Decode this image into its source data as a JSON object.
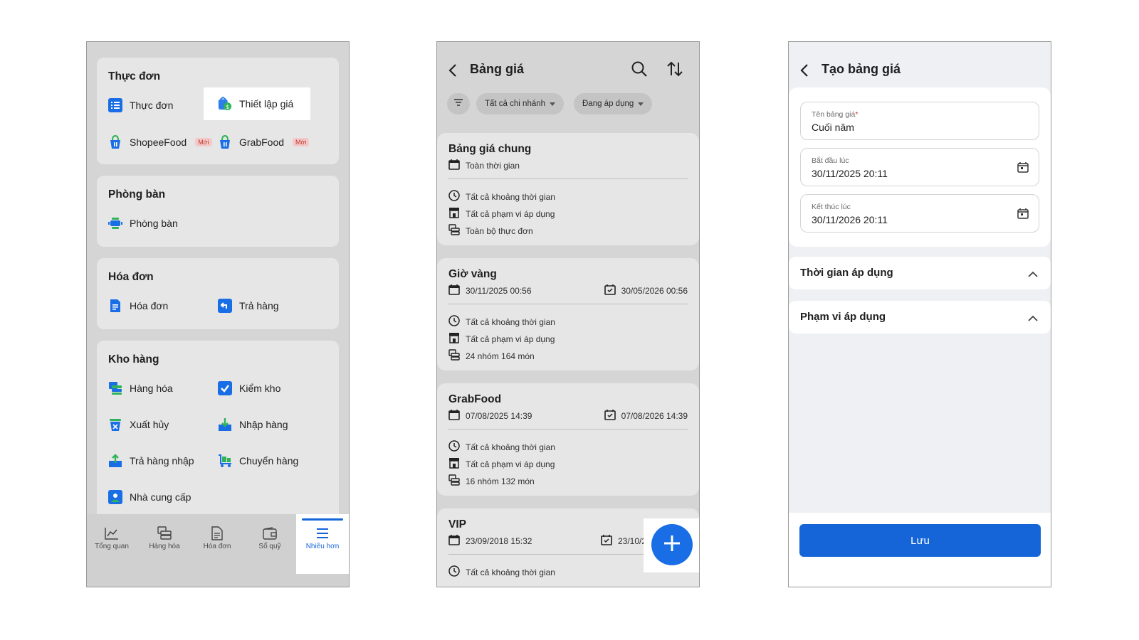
{
  "screen1": {
    "sections": [
      {
        "title": "Thực đơn",
        "items": [
          "Thực đơn",
          "Thiết lập giá",
          "ShopeeFood",
          "GrabFood"
        ],
        "new_badge": "Mới"
      },
      {
        "title": "Phòng bàn",
        "items": [
          "Phòng bàn"
        ]
      },
      {
        "title": "Hóa đơn",
        "items": [
          "Hóa đơn",
          "Trả hàng"
        ]
      },
      {
        "title": "Kho hàng",
        "items": [
          "Hàng hóa",
          "Kiểm kho",
          "Xuất hủy",
          "Nhập hàng",
          "Trả hàng nhập",
          "Chuyển hàng",
          "Nhà cung cấp"
        ]
      }
    ],
    "bottom_nav": [
      "Tổng quan",
      "Hàng hóa",
      "Hóa đơn",
      "Sổ quỹ",
      "Nhiều hơn"
    ],
    "active_nav": "Nhiều hơn",
    "highlighted_item": "Thiết lập giá"
  },
  "screen2": {
    "title": "Bảng giá",
    "filters": [
      "Tất cả chi nhánh",
      "Đang áp dụng"
    ],
    "price_lists": [
      {
        "name": "Bảng giá chung",
        "period": "Toàn thời gian",
        "time": "Tất cả khoảng thời gian",
        "scope": "Tất cả phạm vi áp dụng",
        "menu": "Toàn bộ thực đơn"
      },
      {
        "name": "Giờ vàng",
        "start": "30/11/2025 00:56",
        "end": "30/05/2026 00:56",
        "time": "Tất cả khoảng thời gian",
        "scope": "Tất cả phạm vi áp dụng",
        "menu": "24 nhóm 164 món"
      },
      {
        "name": "GrabFood",
        "start": "07/08/2025 14:39",
        "end": "07/08/2026 14:39",
        "time": "Tất cả khoảng thời gian",
        "scope": "Tất cả phạm vi áp dụng",
        "menu": "16 nhóm 132 món"
      },
      {
        "name": "VIP",
        "start": "23/09/2018 15:32",
        "end": "23/10/2",
        "time": "Tất cả khoảng thời gian"
      }
    ]
  },
  "screen3": {
    "title": "Tạo bảng giá",
    "fields": [
      {
        "label": "Tên bảng giá",
        "required_mark": "*",
        "value": "Cuối năm"
      },
      {
        "label": "Bắt đầu lúc",
        "value": "30/11/2025 20:11"
      },
      {
        "label": "Kết thúc lúc",
        "value": "30/11/2026 20:11"
      }
    ],
    "sections": [
      "Thời gian áp dụng",
      "Phạm vi áp dụng"
    ],
    "save_label": "Lưu"
  },
  "colors": {
    "primary": "#1565d8",
    "new_badge": "#c0392b",
    "dimmed_bg": "#d5d5d5"
  }
}
